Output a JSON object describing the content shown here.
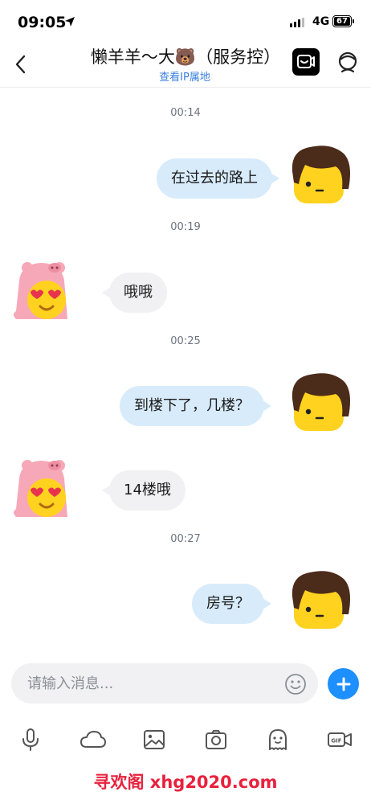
{
  "status_bar": {
    "time": "09:05",
    "network": "4G",
    "battery": "67"
  },
  "header": {
    "title": "懒羊羊～大🐻（服务控）",
    "subtitle": "查看IP属地"
  },
  "messages": [
    {
      "type": "timestamp",
      "text": "00:14"
    },
    {
      "type": "outgoing",
      "text": "在过去的路上"
    },
    {
      "type": "timestamp",
      "text": "00:19"
    },
    {
      "type": "incoming",
      "text": "哦哦"
    },
    {
      "type": "timestamp",
      "text": "00:25"
    },
    {
      "type": "outgoing",
      "text": "到楼下了，几楼？"
    },
    {
      "type": "incoming",
      "text": "14楼哦"
    },
    {
      "type": "timestamp",
      "text": "00:27"
    },
    {
      "type": "outgoing",
      "text": "房号？"
    }
  ],
  "input": {
    "placeholder": "请输入消息..."
  },
  "toolbar": [
    "microphone-icon",
    "cloud-icon",
    "image-icon",
    "camera-icon",
    "sticker-icon",
    "gif-video-icon"
  ],
  "watermark": "寻欢阁 xhg2020.com",
  "colors": {
    "accent": "#1e8fff",
    "outgoing_bubble": "#d8ebfb",
    "incoming_bubble": "#f1f1f3",
    "link": "#3a7fe0",
    "watermark": "#e8213d"
  }
}
